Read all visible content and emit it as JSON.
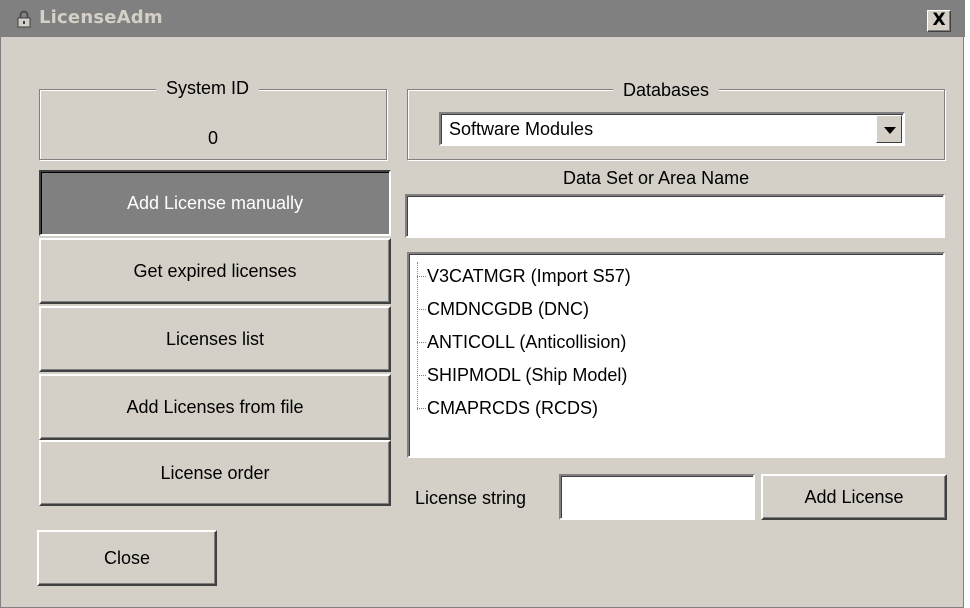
{
  "window": {
    "title": "LicenseAdm",
    "close_glyph": "X",
    "icon": "lock-icon"
  },
  "system_id": {
    "label": "System ID",
    "value": "0"
  },
  "menu": {
    "items": [
      {
        "label": "Add License manually",
        "active": true
      },
      {
        "label": "Get expired licenses",
        "active": false
      },
      {
        "label": "Licenses list",
        "active": false
      },
      {
        "label": "Add Licenses from file",
        "active": false
      },
      {
        "label": "License order",
        "active": false
      }
    ]
  },
  "databases": {
    "label": "Databases",
    "selected": "Software Modules"
  },
  "dataset": {
    "label": "Data Set or Area Name",
    "value": ""
  },
  "modules": [
    "V3CATMGR (Import S57)",
    "CMDNCGDB (DNC)",
    "ANTICOLL (Anticollision)",
    "SHIPMODL (Ship Model)",
    "CMAPRCDS (RCDS)"
  ],
  "license": {
    "label": "License string",
    "value": "",
    "add_button": "Add License"
  },
  "close_button": "Close",
  "colors": {
    "face": "#d4d0c8",
    "titlebar": "#808080",
    "active_button": "#808080"
  }
}
